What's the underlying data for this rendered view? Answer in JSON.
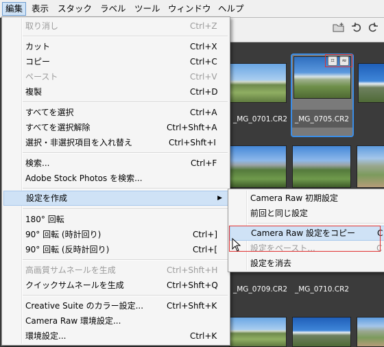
{
  "menubar": {
    "items": [
      "編集",
      "表示",
      "スタック",
      "ラベル",
      "ツール",
      "ウィンドウ",
      "ヘルプ"
    ]
  },
  "toolbar": {
    "icons": [
      "new-folder-icon",
      "rotate-left-icon",
      "rotate-right-icon"
    ]
  },
  "thumbnails": {
    "row1": [
      "_MG_0701.CR2",
      "_MG_0705.CR2"
    ],
    "row3": [
      "_MG_0709.CR2",
      "_MG_0710.CR2"
    ],
    "badges": [
      "crop-badge-icon",
      "adjust-badge-icon"
    ]
  },
  "edit_menu": {
    "undo": {
      "label": "取り消し",
      "shortcut": "Ctrl+Z"
    },
    "cut": {
      "label": "カット",
      "shortcut": "Ctrl+X"
    },
    "copy": {
      "label": "コピー",
      "shortcut": "Ctrl+C"
    },
    "paste": {
      "label": "ペースト",
      "shortcut": "Ctrl+V"
    },
    "duplicate": {
      "label": "複製",
      "shortcut": "Ctrl+D"
    },
    "select_all": {
      "label": "すべてを選択",
      "shortcut": "Ctrl+A"
    },
    "deselect_all": {
      "label": "すべてを選択解除",
      "shortcut": "Ctrl+Shft+A"
    },
    "invert_selection": {
      "label": "選択・非選択項目を入れ替え",
      "shortcut": "Ctrl+Shft+I"
    },
    "find": {
      "label": "検索...",
      "shortcut": "Ctrl+F"
    },
    "stock_search": {
      "label": "Adobe Stock Photos を検索..."
    },
    "develop_settings": {
      "label": "設定を作成"
    },
    "rotate_180": {
      "label": "180° 回転"
    },
    "rotate_cw": {
      "label": "90° 回転 (時計回り)",
      "shortcut": "Ctrl+]"
    },
    "rotate_ccw": {
      "label": "90° 回転 (反時計回り)",
      "shortcut": "Ctrl+["
    },
    "hq_thumbs": {
      "label": "高画質サムネールを生成",
      "shortcut": "Ctrl+Shft+H"
    },
    "quick_thumbs": {
      "label": "クイックサムネールを生成",
      "shortcut": "Ctrl+Shft+Q"
    },
    "color_settings": {
      "label": "Creative Suite のカラー設定...",
      "shortcut": "Ctrl+Shft+K"
    },
    "camera_raw_prefs": {
      "label": "Camera Raw 環境設定..."
    },
    "preferences": {
      "label": "環境設定...",
      "shortcut": "Ctrl+K"
    }
  },
  "submenu": {
    "defaults": {
      "label": "Camera Raw 初期設定"
    },
    "previous": {
      "label": "前回と同じ設定"
    },
    "copy_settings": {
      "label": "Camera Raw 設定をコピー",
      "shortcut": "C"
    },
    "paste_settings": {
      "label": "設定をペースト...",
      "shortcut": "C"
    },
    "clear_settings": {
      "label": "設定を消去"
    }
  }
}
